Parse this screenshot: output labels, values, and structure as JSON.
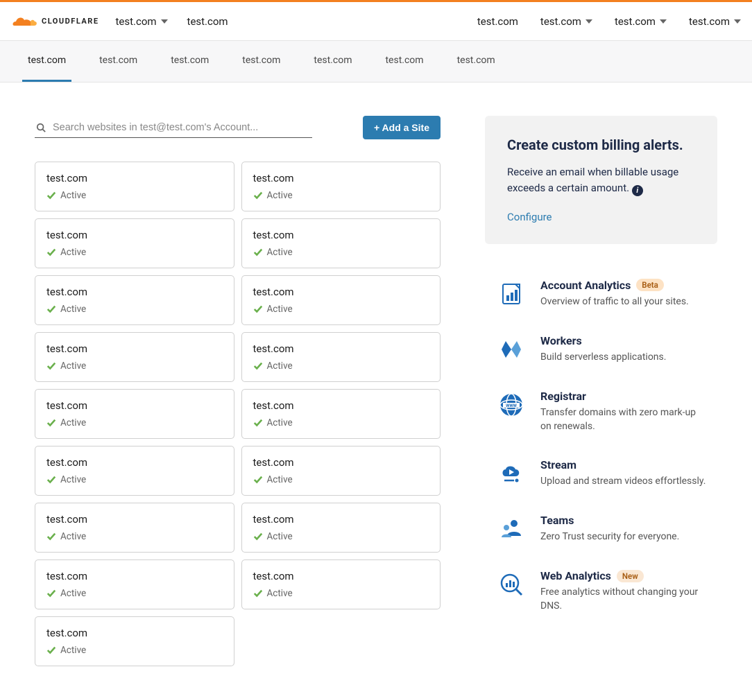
{
  "brand": {
    "name": "CLOUDFLARE"
  },
  "header": {
    "left": [
      {
        "label": "test.com",
        "dropdown": true
      },
      {
        "label": "test.com",
        "dropdown": false
      }
    ],
    "right": [
      {
        "label": "test.com",
        "dropdown": false
      },
      {
        "label": "test.com",
        "dropdown": true
      },
      {
        "label": "test.com",
        "dropdown": true
      },
      {
        "label": "test.com",
        "dropdown": true
      }
    ]
  },
  "subnav": {
    "items": [
      {
        "label": "test.com",
        "active": true
      },
      {
        "label": "test.com",
        "active": false
      },
      {
        "label": "test.com",
        "active": false
      },
      {
        "label": "test.com",
        "active": false
      },
      {
        "label": "test.com",
        "active": false
      },
      {
        "label": "test.com",
        "active": false
      },
      {
        "label": "test.com",
        "active": false
      }
    ]
  },
  "search": {
    "placeholder": "Search websites in test@test.com's Account..."
  },
  "add_site_label": "+ Add a Site",
  "sites": [
    {
      "name": "test.com",
      "status": "Active"
    },
    {
      "name": "test.com",
      "status": "Active"
    },
    {
      "name": "test.com",
      "status": "Active"
    },
    {
      "name": "test.com",
      "status": "Active"
    },
    {
      "name": "test.com",
      "status": "Active"
    },
    {
      "name": "test.com",
      "status": "Active"
    },
    {
      "name": "test.com",
      "status": "Active"
    },
    {
      "name": "test.com",
      "status": "Active"
    },
    {
      "name": "test.com",
      "status": "Active"
    },
    {
      "name": "test.com",
      "status": "Active"
    },
    {
      "name": "test.com",
      "status": "Active"
    },
    {
      "name": "test.com",
      "status": "Active"
    },
    {
      "name": "test.com",
      "status": "Active"
    },
    {
      "name": "test.com",
      "status": "Active"
    },
    {
      "name": "test.com",
      "status": "Active"
    },
    {
      "name": "test.com",
      "status": "Active"
    },
    {
      "name": "test.com",
      "status": "Active"
    }
  ],
  "promo": {
    "title": "Create custom billing alerts.",
    "desc": "Receive an email when billable usage exceeds a certain amount.",
    "link": "Configure"
  },
  "features": [
    {
      "icon": "analytics",
      "title": "Account Analytics",
      "badge": "Beta",
      "badge_kind": "beta",
      "desc": "Overview of traffic to all your sites."
    },
    {
      "icon": "workers",
      "title": "Workers",
      "badge": "",
      "badge_kind": "",
      "desc": "Build serverless applications."
    },
    {
      "icon": "registrar",
      "title": "Registrar",
      "badge": "",
      "badge_kind": "",
      "desc": "Transfer domains with zero mark-up on renewals."
    },
    {
      "icon": "stream",
      "title": "Stream",
      "badge": "",
      "badge_kind": "",
      "desc": "Upload and stream videos effortlessly."
    },
    {
      "icon": "teams",
      "title": "Teams",
      "badge": "",
      "badge_kind": "",
      "desc": "Zero Trust security for everyone."
    },
    {
      "icon": "webanalytics",
      "title": "Web Analytics",
      "badge": "New",
      "badge_kind": "new",
      "desc": "Free analytics without changing your DNS."
    }
  ]
}
